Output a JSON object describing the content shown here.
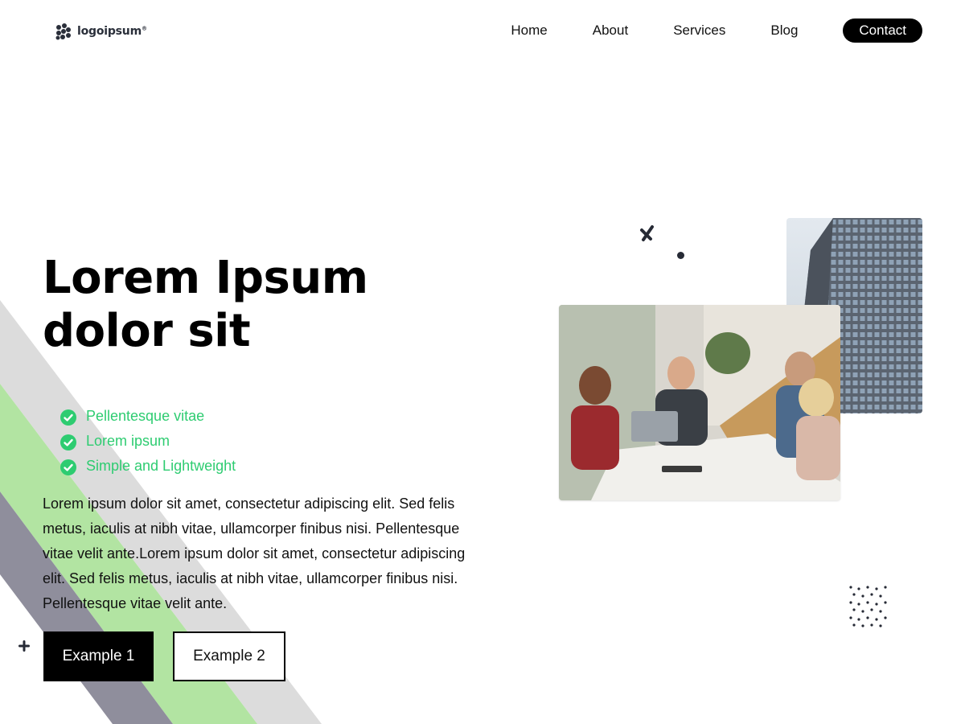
{
  "brand": {
    "logo_text": "logoipsum",
    "logo_mark": "®",
    "logo_icon": "logo-mark-icon"
  },
  "nav": {
    "items": [
      {
        "label": "Home"
      },
      {
        "label": "About"
      },
      {
        "label": "Services"
      },
      {
        "label": "Blog"
      }
    ],
    "contact_label": "Contact"
  },
  "hero": {
    "title_line1": "Lorem Ipsum",
    "title_line2": "dolor sit",
    "features": [
      {
        "label": "Pellentesque vitae",
        "icon": "check-circle-icon"
      },
      {
        "label": "Lorem ipsum",
        "icon": "check-circle-icon"
      },
      {
        "label": "Simple and Lightweight",
        "icon": "check-circle-icon"
      }
    ],
    "description": "Lorem ipsum dolor sit amet, consectetur adipiscing elit. Sed felis metus, iaculis at nibh vitae, ullamcorper finibus nisi. Pellentesque vitae velit ante.Lorem ipsum dolor sit amet, consectetur adipiscing elit. Sed felis metus, iaculis at nibh vitae, ullamcorper finibus nisi. Pellentesque vitae velit ante.",
    "button_primary": "Example 1",
    "button_secondary": "Example 2"
  },
  "colors": {
    "accent_green": "#2ecc71",
    "stripe_light": "#dcdcdc",
    "stripe_green": "#b2e4a2",
    "stripe_gray": "#8f8e9c",
    "dark_decor": "#262a35"
  }
}
